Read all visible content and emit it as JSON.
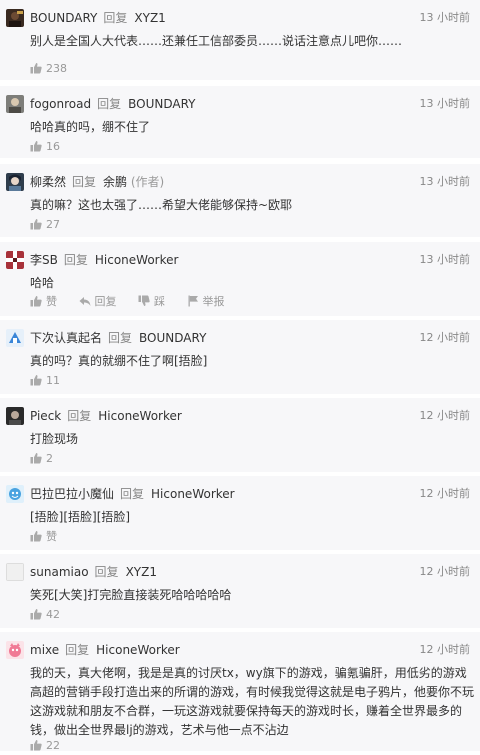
{
  "reply_word": "回复",
  "comments": [
    {
      "username": "BOUNDARY",
      "reply_to": "XYZ1",
      "time": "13 小时前",
      "text": "别人是全国人大代表……还兼任工信部委员……说话注意点儿吧你……",
      "likes": "238",
      "avatar": "avatar-dark-character"
    },
    {
      "username": "fogonroad",
      "reply_to": "BOUNDARY",
      "time": "13 小时前",
      "text": "哈哈真的吗，绷不住了",
      "likes": "16",
      "avatar": "avatar-portrait"
    },
    {
      "username": "柳柔然",
      "reply_to": "余鹏",
      "author_tag": "(作者)",
      "time": "13 小时前",
      "text": "真的嘛？这也太强了……希望大佬能够保持~欧耶",
      "likes": "27",
      "avatar": "avatar-anime"
    },
    {
      "username": "李SB",
      "reply_to": "HiconeWorker",
      "time": "13 小时前",
      "text": "哈哈",
      "actions": [
        "赞",
        "回复",
        "踩",
        "举报"
      ],
      "avatar": "avatar-red-pattern"
    },
    {
      "username": "下次认真起名",
      "reply_to": "BOUNDARY",
      "time": "12 小时前",
      "text": "真的吗？真的就绷不住了啊[捂脸]",
      "likes": "11",
      "avatar": "avatar-blue-logo"
    },
    {
      "username": "Pieck",
      "reply_to": "HiconeWorker",
      "time": "12 小时前",
      "text": "打脸现场",
      "likes": "2",
      "avatar": "avatar-dark-portrait"
    },
    {
      "username": "巴拉巴拉小魔仙",
      "reply_to": "HiconeWorker",
      "time": "12 小时前",
      "text": "[捂脸][捂脸][捂脸]",
      "likes": "赞",
      "avatar": "avatar-blue-cartoon"
    },
    {
      "username": "sunamiao",
      "reply_to": "XYZ1",
      "time": "12 小时前",
      "text": "笑死[大笑]打完脸直接装死哈哈哈哈哈",
      "likes": "42",
      "avatar": "avatar-blank"
    },
    {
      "username": "mixe",
      "reply_to": "HiconeWorker",
      "time": "12 小时前",
      "text": "我的天，真大佬啊，我是是真的讨厌tx，wy旗下的游戏，骗氪骗肝，用低劣的游戏高超的营销手段打造出来的所谓的游戏，有时候我觉得这就是电子鸦片，他要你不玩这游戏就和朋友不合群，一玩这游戏就要保持每天的游戏时长，赚着全世界最多的钱，做出全世界最lj的游戏，艺术与他一点不沾边",
      "likes": "22",
      "avatar": "avatar-pink-cartoon"
    }
  ]
}
